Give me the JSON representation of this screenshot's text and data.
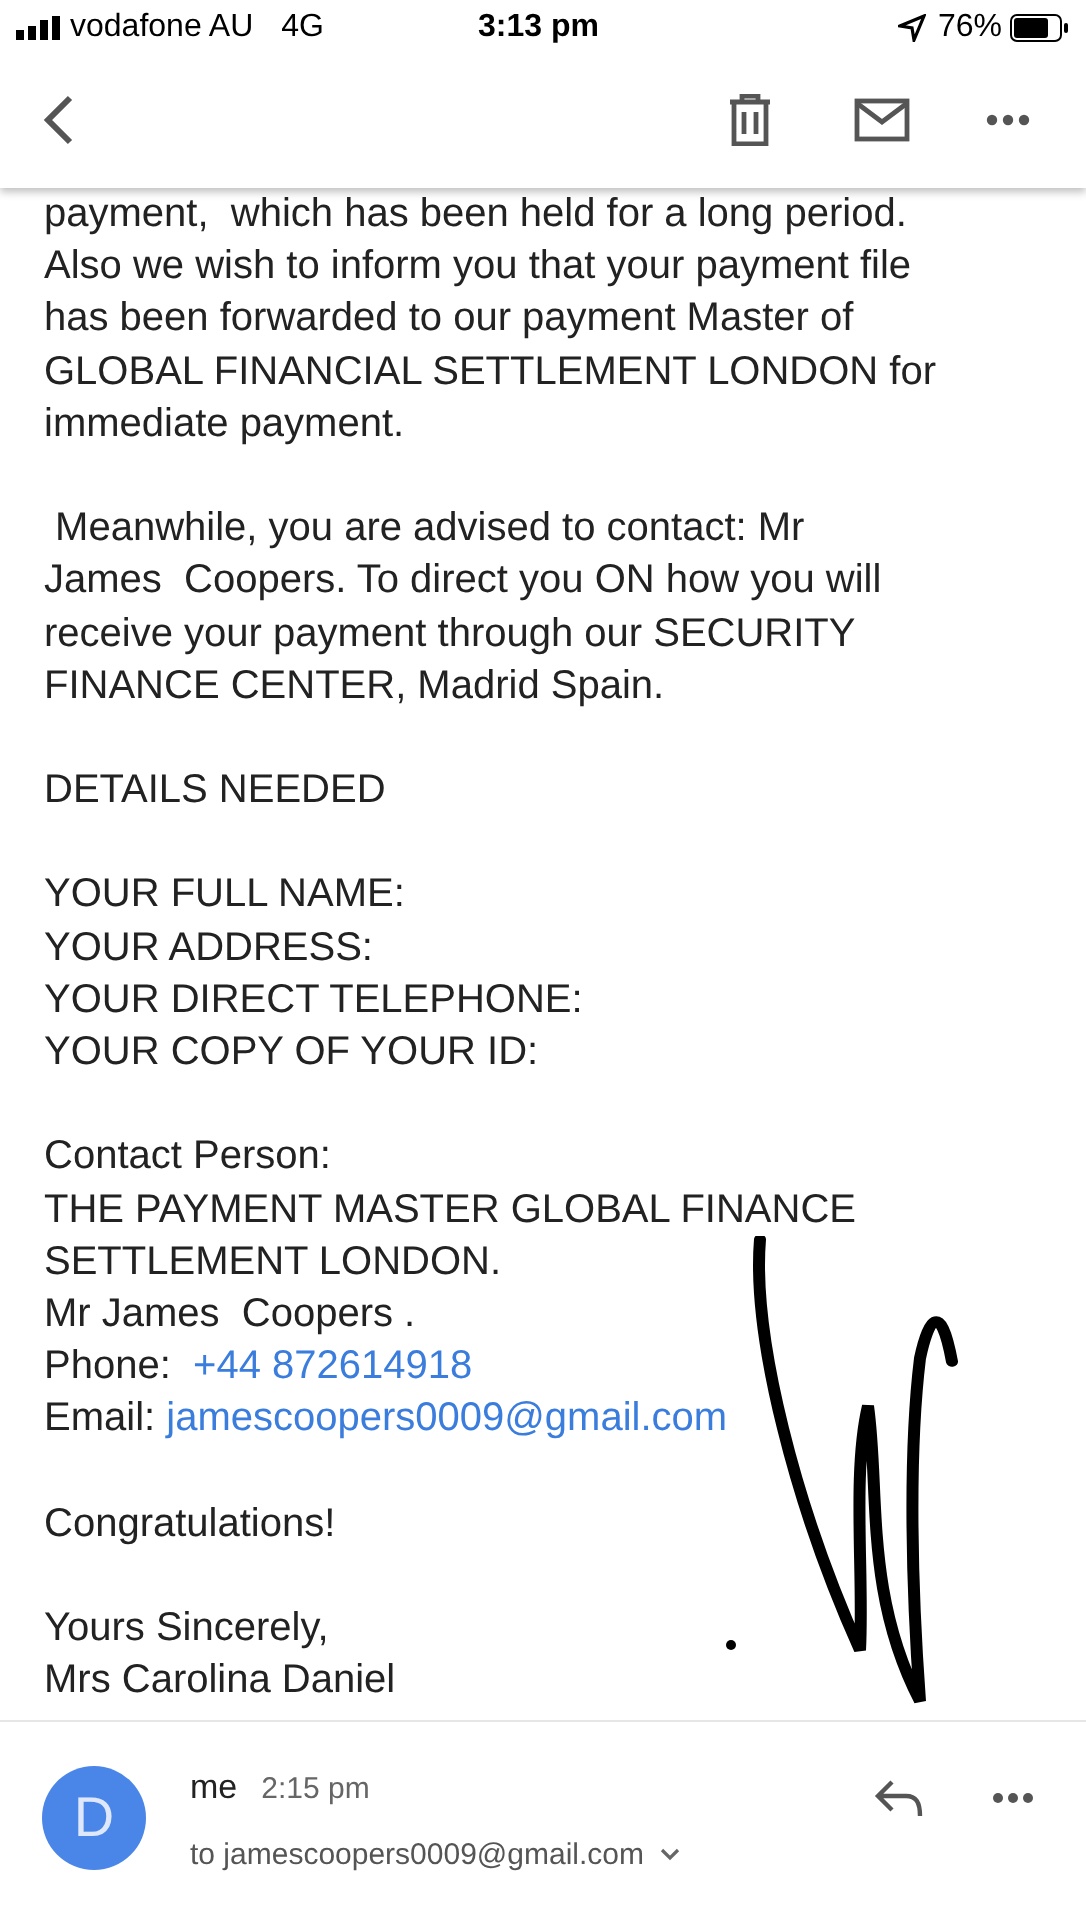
{
  "status_bar": {
    "carrier": "vodafone AU",
    "network": "4G",
    "time": "3:13 pm",
    "battery": "76%"
  },
  "body": [
    {
      "lines": [
        {
          "text": "payment,  which has been held for a long period."
        },
        {
          "text": "Also we wish to inform you that your payment file"
        },
        {
          "text": "has been forwarded to our payment Master of"
        },
        {
          "text": "GLOBAL FINANCIAL SETTLEMENT LONDON for"
        },
        {
          "text": "immediate payment."
        }
      ]
    },
    {
      "lines": [
        {
          "text": " Meanwhile, you are advised to contact: Mr"
        },
        {
          "text": "James  Coopers. To direct you ON how you will"
        },
        {
          "text": "receive your payment through our SECURITY"
        },
        {
          "text": "FINANCE CENTER, Madrid Spain."
        }
      ]
    },
    {
      "lines": [
        {
          "text": "DETAILS NEEDED"
        }
      ]
    },
    {
      "lines": [
        {
          "text": "YOUR FULL NAME:"
        },
        {
          "text": "YOUR ADDRESS:"
        },
        {
          "text": "YOUR DIRECT TELEPHONE:"
        },
        {
          "text": "YOUR COPY OF YOUR ID:"
        }
      ]
    },
    {
      "lines": [
        {
          "text": "Contact Person:"
        },
        {
          "text": "THE PAYMENT MASTER GLOBAL FINANCE"
        },
        {
          "text": "SETTLEMENT LONDON."
        },
        {
          "text": "Mr James  Coopers ."
        },
        {
          "text": "Phone:  ",
          "link": "+44 872614918"
        },
        {
          "text": "Email: ",
          "link": "jamescoopers0009@gmail.com"
        }
      ]
    },
    {
      "lines": [
        {
          "text": "Congratulations!"
        }
      ]
    },
    {
      "lines": [
        {
          "text": "Yours Sincerely,"
        },
        {
          "text": "Mrs Carolina Daniel"
        }
      ]
    }
  ],
  "next_message": {
    "avatar": "D",
    "sender": "me",
    "time": "2:15 pm",
    "to": "to jamescoopers0009@gmail.com"
  }
}
